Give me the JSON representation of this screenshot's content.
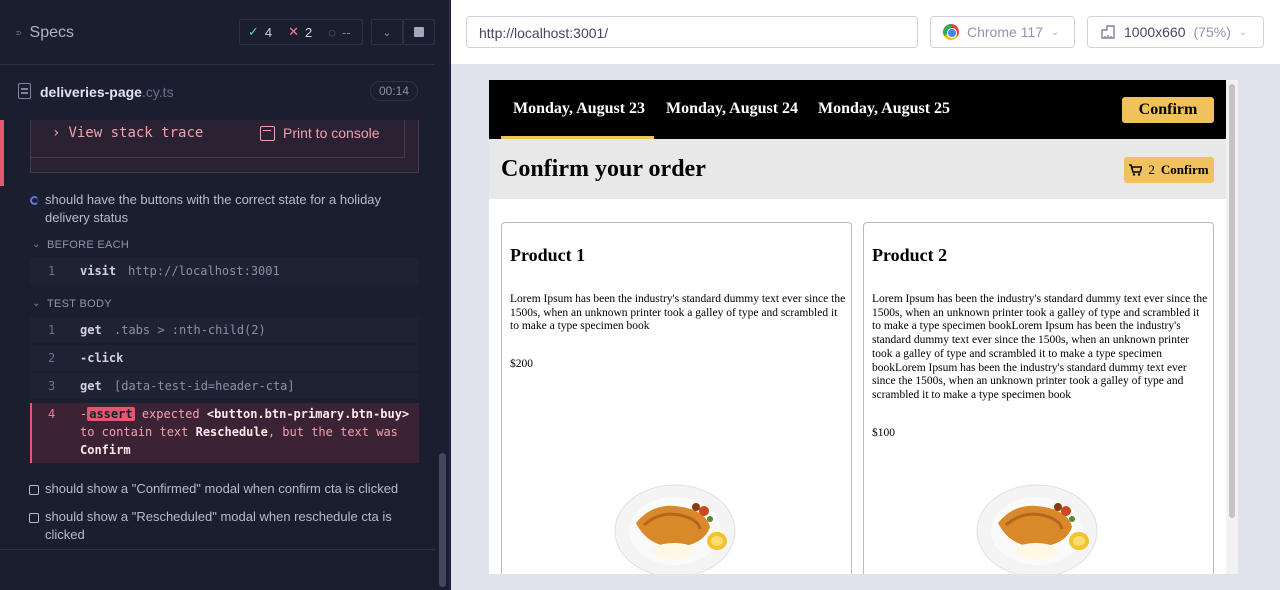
{
  "sidebar": {
    "specs_label": "Specs",
    "stats": {
      "passed": "4",
      "failed": "2",
      "pending": "--"
    },
    "file": {
      "name": "deliveries-page",
      "ext": ".cy.ts",
      "duration": "00:14"
    },
    "error": {
      "stack_trace": "View stack trace",
      "print_console": "Print to console"
    },
    "tests": [
      {
        "title": "should have the buttons with the correct state for a holiday delivery status",
        "state": "running"
      },
      {
        "title": "should show a \"Confirmed\" modal when confirm cta is clicked",
        "state": "pending"
      },
      {
        "title": "should show a \"Rescheduled\" modal when reschedule cta is clicked",
        "state": "pending"
      }
    ],
    "before_each": {
      "label": "BEFORE EACH",
      "commands": [
        {
          "num": "1",
          "name": "visit",
          "arg": "http://localhost:3001"
        }
      ]
    },
    "test_body": {
      "label": "TEST BODY",
      "commands": [
        {
          "num": "1",
          "name": "get",
          "arg": ".tabs > :nth-child(2)"
        },
        {
          "num": "2",
          "name": "-click",
          "arg": ""
        },
        {
          "num": "3",
          "name": "get",
          "arg": "[data-test-id=header-cta]"
        }
      ],
      "assert": {
        "num": "4",
        "prefix": "-",
        "badge": "assert",
        "expected": "expected",
        "subject": "<button.btn-primary.btn-buy>",
        "to_contain": "to contain text",
        "expected_value": "Reschedule",
        "but": ", but the text was",
        "actual": "Confirm"
      }
    }
  },
  "browser": {
    "url": "http://localhost:3001/",
    "name": "Chrome 117",
    "viewport": "1000x660",
    "scale": "(75%)"
  },
  "app": {
    "tabs": [
      "Monday, August 23",
      "Monday, August 24",
      "Monday, August 25"
    ],
    "nav_confirm": "Confirm",
    "title": "Confirm your order",
    "cart_count": "2",
    "header_cta": "Confirm",
    "products": [
      {
        "name": "Product 1",
        "description": "Lorem Ipsum has been the industry's standard dummy text ever since the 1500s, when an unknown printer took a galley of type and scrambled it to make a type specimen book",
        "price": "$200"
      },
      {
        "name": "Product 2",
        "description": "Lorem Ipsum has been the industry's standard dummy text ever since the 1500s, when an unknown printer took a galley of type and scrambled it to make a type specimen bookLorem Ipsum has been the industry's standard dummy text ever since the 1500s, when an unknown printer took a galley of type and scrambled it to make a type specimen bookLorem Ipsum has been the industry's standard dummy text ever since the 1500s, when an unknown printer took a galley of type and scrambled it to make a type specimen book",
        "price": "$100"
      }
    ]
  },
  "colors": {
    "accent": "#f1c15b",
    "fail": "#e45770",
    "pass": "#4fd1a1",
    "sidebar_bg": "#1b1e2e"
  }
}
